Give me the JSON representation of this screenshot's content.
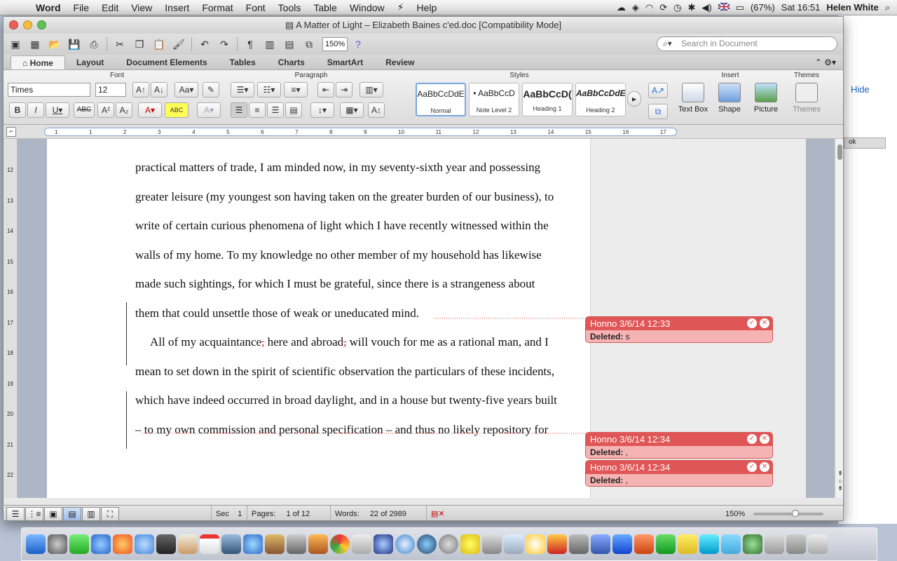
{
  "menubar": {
    "app": "Word",
    "items": [
      "File",
      "Edit",
      "View",
      "Insert",
      "Format",
      "Font",
      "Tools",
      "Table",
      "Window",
      "Help"
    ],
    "flag": "GB",
    "battery": "(67%)",
    "clock": "Sat 16:51",
    "user": "Helen White"
  },
  "window": {
    "title": "A Matter of Light – Elizabeth Baines c'ed.doc [Compatibility Mode]"
  },
  "toolbar": {
    "zoom": "150%",
    "search_placeholder": "Search in Document"
  },
  "ribbon": {
    "tabs": [
      "Home",
      "Layout",
      "Document Elements",
      "Tables",
      "Charts",
      "SmartArt",
      "Review"
    ],
    "active_tab": "Home",
    "groups": {
      "font": "Font",
      "paragraph": "Paragraph",
      "styles": "Styles",
      "insert": "Insert",
      "themes": "Themes"
    },
    "font_name": "Times",
    "font_size": "12",
    "styles": [
      {
        "preview": "AaBbCcDdE",
        "label": "Normal"
      },
      {
        "preview": "• AaBbCcD",
        "label": "Note Level 2"
      },
      {
        "preview": "AaBbCcD(",
        "label": "Heading 1"
      },
      {
        "preview": "AaBbCcDdE",
        "label": "Heading 2"
      }
    ],
    "insert_buttons": [
      "Text Box",
      "Shape",
      "Picture"
    ],
    "themes_button": "Themes"
  },
  "ruler": {
    "h_ticks": [
      "1",
      "1",
      "2",
      "3",
      "4",
      "5",
      "6",
      "7",
      "8",
      "9",
      "10",
      "11",
      "12",
      "13",
      "14",
      "15",
      "16",
      "17"
    ],
    "v_ticks": [
      "12",
      "13",
      "14",
      "15",
      "16",
      "17",
      "18",
      "19",
      "20",
      "21",
      "22"
    ]
  },
  "document": {
    "lines": [
      {
        "pre": "practical matters of trade, I am minded now, in my seventy-sixth year and possessing"
      },
      {
        "pre": "greater leisure (my youngest son having taken on the greater burden of our business), to"
      },
      {
        "pre": "write of certain curious phenomena of light which I have recently witnessed within the"
      },
      {
        "pre": "walls of my home. To my knowledge no other member of my household has likewise"
      },
      {
        "pre": "made such sightings, for which I must be grateful, since there is a strangeness about"
      },
      {
        "pre": "them that could unsettle those of weak or uneducated mind."
      },
      {
        "pre": "All of my acquaintance"
      },
      {
        "pre": "mean to set down in the spirit of scientific observation the particulars of these incidents,"
      },
      {
        "pre": "which have indeed occurred in broad daylight, and in a house but twenty-five years built"
      },
      {
        "pre": "– to my own commission and personal specification – and thus no likely repository for"
      }
    ],
    "line7_mid1": " here and abroad",
    "line7_mid2": " will vouch for me as a rational man, and I",
    "deleted_comma": ","
  },
  "comments": [
    {
      "header": "Honno 3/6/14 12:33",
      "label": "Deleted:",
      "value": " s"
    },
    {
      "header": "Honno 3/6/14 12:34",
      "label": "Deleted:",
      "value": " ,"
    },
    {
      "header": "Honno 3/6/14 12:34",
      "label": "Deleted:",
      "value": " ,"
    }
  ],
  "statusbar": {
    "sec_label": "Sec",
    "sec_value": "1",
    "pages_label": "Pages:",
    "pages_value": "1 of 12",
    "words_label": "Words:",
    "words_value": "22 of 2989",
    "zoom": "150%"
  },
  "background_window": {
    "hide_link": "Hide",
    "button": "ok"
  },
  "colors": {
    "accent": "#e05555",
    "comment_body": "#f6b3b3",
    "ruler": "#8aa6d0"
  }
}
